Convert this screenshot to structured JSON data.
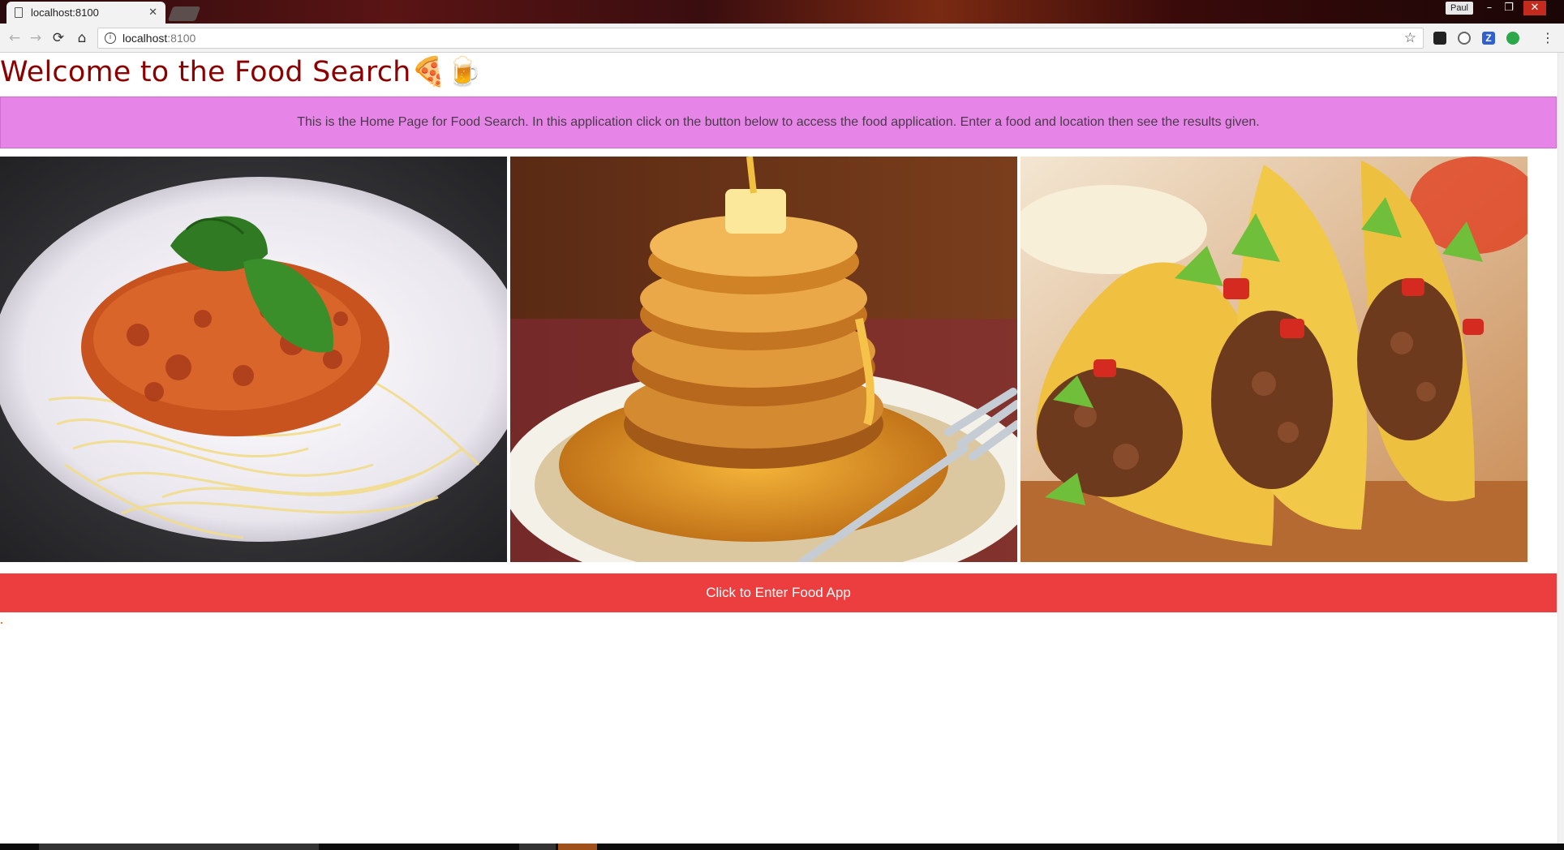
{
  "browser": {
    "tab_title": "localhost:8100",
    "tab_close": "✕",
    "profile_name": "Paul",
    "url_host": "localhost",
    "url_port": ":8100"
  },
  "page": {
    "title": "Welcome to the Food Search",
    "title_emoji": "🍕🍺",
    "description": "This is the Home Page for Food Search. In this application click on the button below to access the food application. Enter a food and location then see the results given.",
    "images": [
      {
        "icon": "spaghetti-photo"
      },
      {
        "icon": "pancakes-photo"
      },
      {
        "icon": "tacos-photo"
      }
    ],
    "enter_button": "Click to Enter Food App"
  },
  "colors": {
    "title": "#8b0000",
    "info_box": "#e784e7",
    "button": "#ec3e3e"
  }
}
